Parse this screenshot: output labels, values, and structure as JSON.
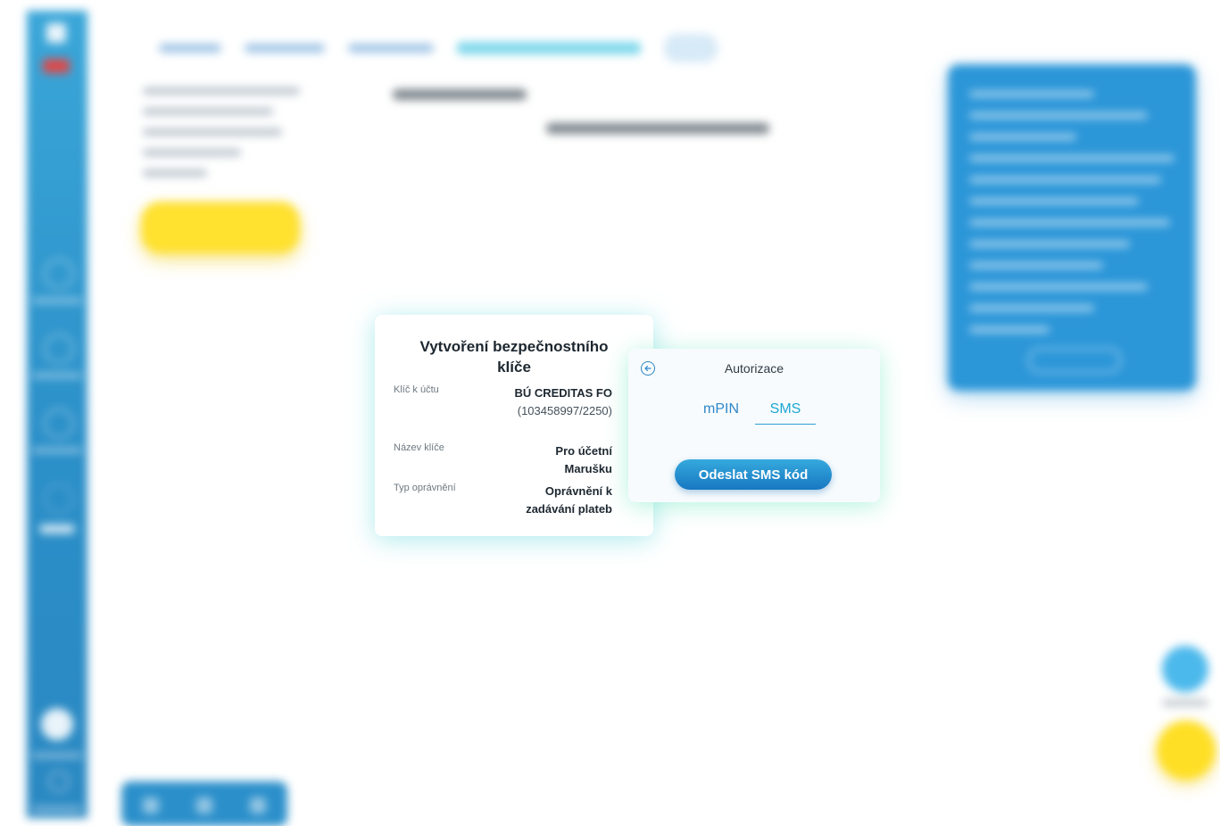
{
  "key_card": {
    "title": "Vytvoření bezpečnostního klíče",
    "rows": [
      {
        "label": "Klíč k účtu",
        "value": "BÚ CREDITAS FO",
        "value_sub": "(103458997/2250)"
      },
      {
        "label": "Název klíče",
        "value": "Pro účetní Marušku",
        "value_sub": ""
      },
      {
        "label": "Typ oprávnění",
        "value": "Oprávnění k zadávání plateb",
        "value_sub": ""
      }
    ]
  },
  "auth": {
    "back_icon": "arrow-left-circle-icon",
    "title": "Autorizace",
    "tabs": [
      "mPIN",
      "SMS"
    ],
    "active_tab": "SMS",
    "send_button": "Odeslat SMS kód"
  },
  "colors": {
    "accent_blue": "#2f87c8",
    "sidebar_blue": "#2b8fc8",
    "accent_yellow": "#ffe130",
    "button_gradient_top": "#35a9de",
    "button_gradient_bottom": "#1878c1"
  }
}
